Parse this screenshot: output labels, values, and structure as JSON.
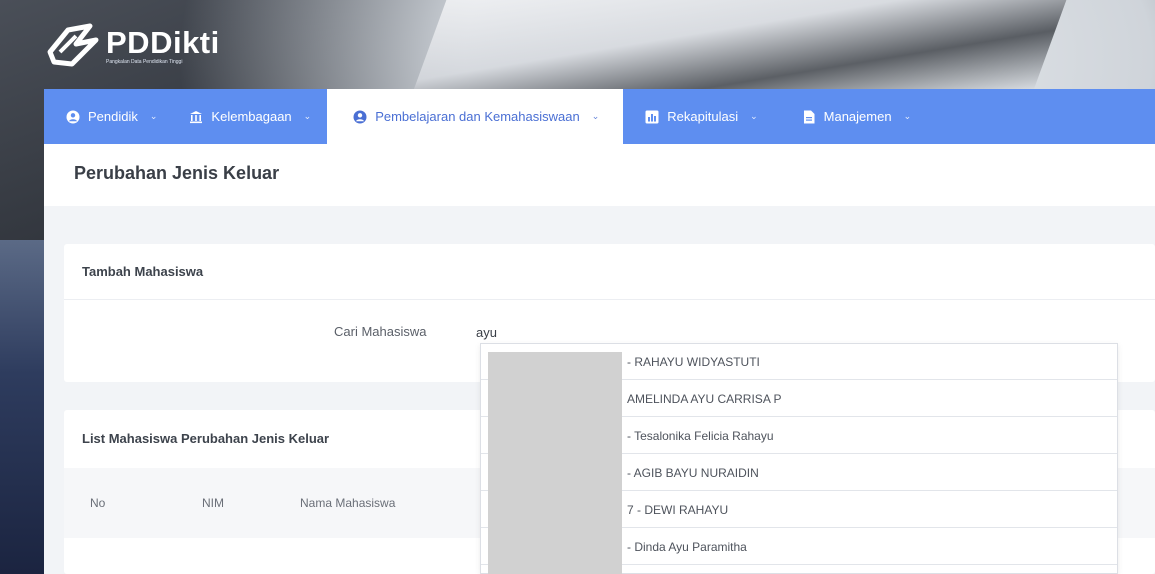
{
  "brand": {
    "name": "PDDikti",
    "subtitle": "Pangkalan Data Pendidikan Tinggi"
  },
  "nav": {
    "items": [
      {
        "label": "Pendidik",
        "icon": "user-circle-icon",
        "active": false
      },
      {
        "label": "Kelembagaan",
        "icon": "institution-icon",
        "active": false
      },
      {
        "label": "Pembelajaran dan Kemahasiswaan",
        "icon": "user-circle-icon",
        "active": true
      },
      {
        "label": "Rekapitulasi",
        "icon": "chart-icon",
        "active": false
      },
      {
        "label": "Manajemen",
        "icon": "document-icon",
        "active": false
      }
    ]
  },
  "page": {
    "title": "Perubahan Jenis Keluar"
  },
  "add_student": {
    "title": "Tambah Mahasiswa",
    "search_label": "Cari Mahasiswa",
    "search_value": "ayu"
  },
  "student_list": {
    "title": "List Mahasiswa Perubahan Jenis Keluar",
    "columns": [
      "No",
      "NIM",
      "Nama Mahasiswa"
    ]
  },
  "suggestions": [
    "- RAHAYU WIDYASTUTI",
    "AMELINDA AYU CARRISA P",
    "- Tesalonika Felicia Rahayu",
    "- AGIB BAYU NURAIDIN",
    "7 - DEWI RAHAYU",
    "- Dinda Ayu Paramitha"
  ],
  "colors": {
    "nav": "#5e8ef0",
    "nav_active_text": "#4a6fd4",
    "page_bg": "#f2f4f7"
  }
}
